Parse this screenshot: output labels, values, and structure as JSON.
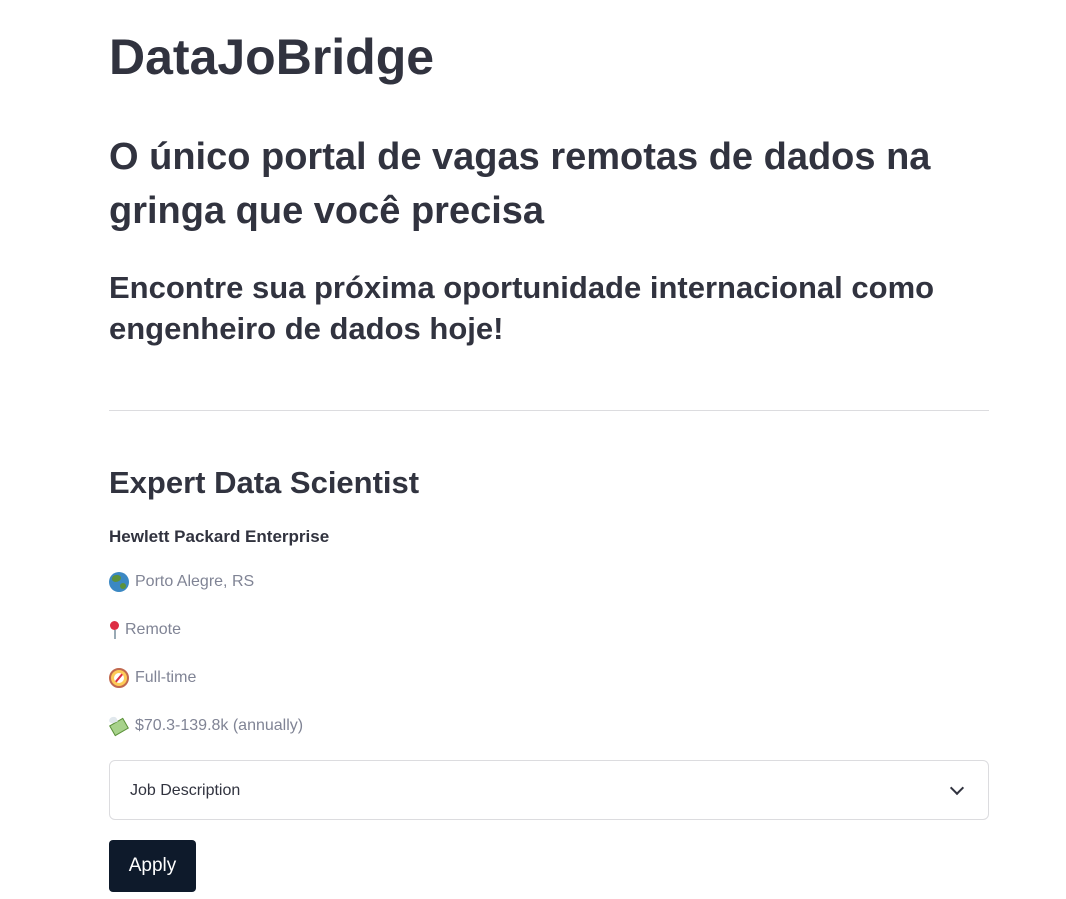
{
  "header": {
    "app_title": "DataJoBridge",
    "headline": "O único portal de vagas remotas de dados na gringa que você precisa",
    "subheadline": "Encontre sua próxima oportunidade internacional como engenheiro de dados hoje!"
  },
  "job": {
    "title": "Expert Data Scientist",
    "company": "Hewlett Packard Enterprise",
    "location": {
      "icon": "globe-icon",
      "text": "Porto Alegre, RS"
    },
    "workplace": {
      "icon": "pin-icon",
      "text": "Remote"
    },
    "employment_type": {
      "icon": "compass-icon",
      "text": "Full-time"
    },
    "salary": {
      "icon": "money-with-wings-icon",
      "text": "$70.3-139.8k (annually)"
    },
    "description_expander": {
      "label": "Job Description",
      "expanded": false
    },
    "apply_label": "Apply"
  },
  "colors": {
    "text": "#31333f",
    "muted": "#808495",
    "divider": "#dcdcdf",
    "button_bg": "#0e1a2b",
    "button_text": "#ffffff"
  }
}
